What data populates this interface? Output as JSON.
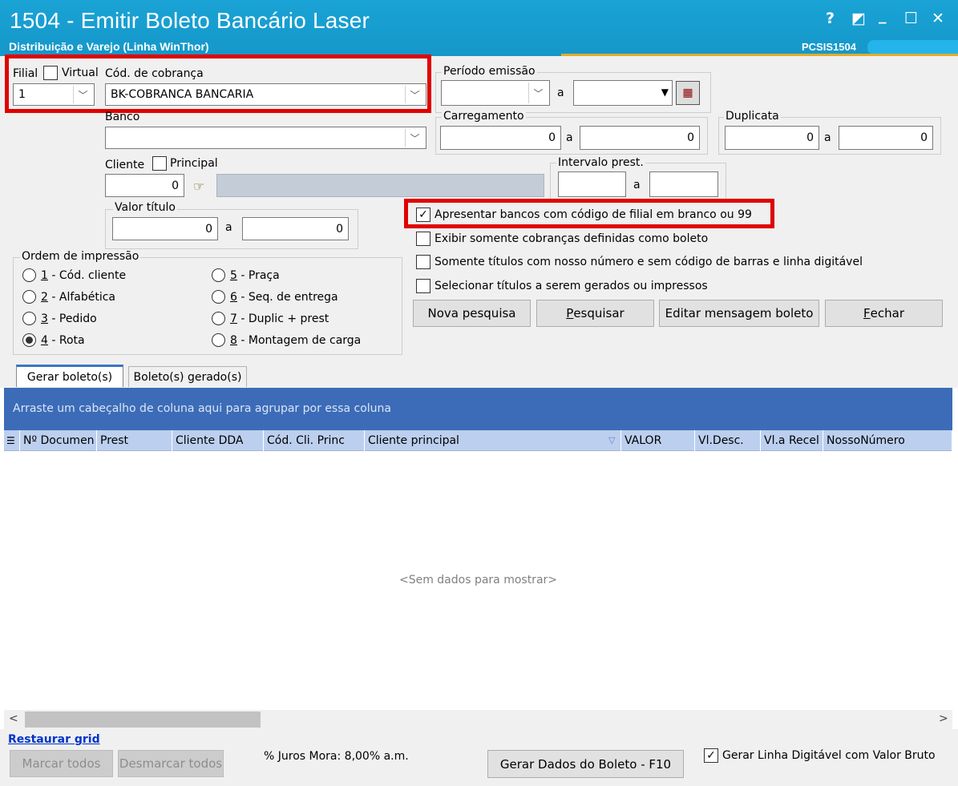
{
  "window": {
    "title": "1504 - Emitir Boleto Bancário Laser",
    "subtitle": "Distribuição e Varejo (Linha WinThor)",
    "code": "PCSIS1504",
    "controls": {
      "help": "?",
      "restore": "◩",
      "minimize": "_",
      "maximize": "☐",
      "close": "✕"
    }
  },
  "form": {
    "filial": {
      "label": "Filial",
      "value": "1"
    },
    "virtual": {
      "label": "Virtual",
      "checked": false
    },
    "cod_cobranca": {
      "label": "Cód. de cobrança",
      "value": "BK-COBRANCA BANCARIA"
    },
    "banco": {
      "label": "Banco",
      "value": ""
    },
    "cliente": {
      "label": "Cliente",
      "value": "0"
    },
    "principal": {
      "label": "Principal",
      "checked": false
    },
    "valor_titulo": {
      "label": "Valor título",
      "from": "0",
      "sep": "a",
      "to": "0"
    },
    "periodo_emissao": {
      "label": "Período emissão",
      "sep": "a",
      "from": "",
      "to": ""
    },
    "carregamento": {
      "label": "Carregamento",
      "from": "0",
      "sep": "a",
      "to": "0"
    },
    "duplicata": {
      "label": "Duplicata",
      "from": "0",
      "sep": "a",
      "to": "0"
    },
    "intervalo_prest": {
      "label": "Intervalo prest.",
      "from": "",
      "sep": "a",
      "to": ""
    },
    "checkboxes": [
      {
        "label": "Apresentar bancos com código de filial em branco ou 99",
        "checked": true
      },
      {
        "label": "Exibir somente cobranças definidas como boleto",
        "checked": false
      },
      {
        "label": "Somente títulos com nosso número e sem código de barras e linha digitável",
        "checked": false
      },
      {
        "label": "Selecionar títulos a serem gerados ou impressos",
        "checked": false
      }
    ],
    "ordem": {
      "label": "Ordem de impressão",
      "options": [
        {
          "num": "1",
          "text": " - Cód. cliente",
          "selected": false
        },
        {
          "num": "2",
          "text": " - Alfabética",
          "selected": false
        },
        {
          "num": "3",
          "text": " - Pedido",
          "selected": false
        },
        {
          "num": "4",
          "text": " - Rota",
          "selected": true
        },
        {
          "num": "5",
          "text": " - Praça",
          "selected": false
        },
        {
          "num": "6",
          "text": " - Seq. de entrega",
          "selected": false
        },
        {
          "num": "7",
          "text": " - Duplic + prest",
          "selected": false
        },
        {
          "num": "8",
          "text": " - Montagem de carga",
          "selected": false
        }
      ]
    },
    "buttons": {
      "nova_pesquisa": "Nova pesquisa",
      "pesquisar_u": "P",
      "pesquisar_rest": "esquisar",
      "editar": "Editar mensagem boleto",
      "fechar_u": "F",
      "fechar_rest": "echar"
    }
  },
  "tabs": [
    {
      "label": "Gerar boleto(s)",
      "active": true
    },
    {
      "label": "Boleto(s) gerado(s)",
      "active": false
    }
  ],
  "grid": {
    "group_hint": "Arraste um cabeçalho de coluna aqui para agrupar por essa coluna",
    "columns": [
      "Nº Documen",
      "Prest",
      "Cliente DDA",
      "Cód. Cli. Princ",
      "Cliente principal",
      "VALOR",
      "Vl.Desc.",
      "Vl.a Recel",
      "NossoNúmero"
    ],
    "empty_text": "<Sem dados para mostrar>",
    "scroll_left": "<",
    "scroll_right": ">"
  },
  "footer": {
    "restaurar": "Restaurar grid",
    "marcar": "Marcar todos",
    "desmarcar": "Desmarcar todos",
    "juros": "% Juros Mora: 8,00% a.m.",
    "gerar_dados": "Gerar Dados do Boleto - F10",
    "gerar_linha": {
      "label": "Gerar Linha Digitável com Valor Bruto",
      "checked": true
    }
  }
}
